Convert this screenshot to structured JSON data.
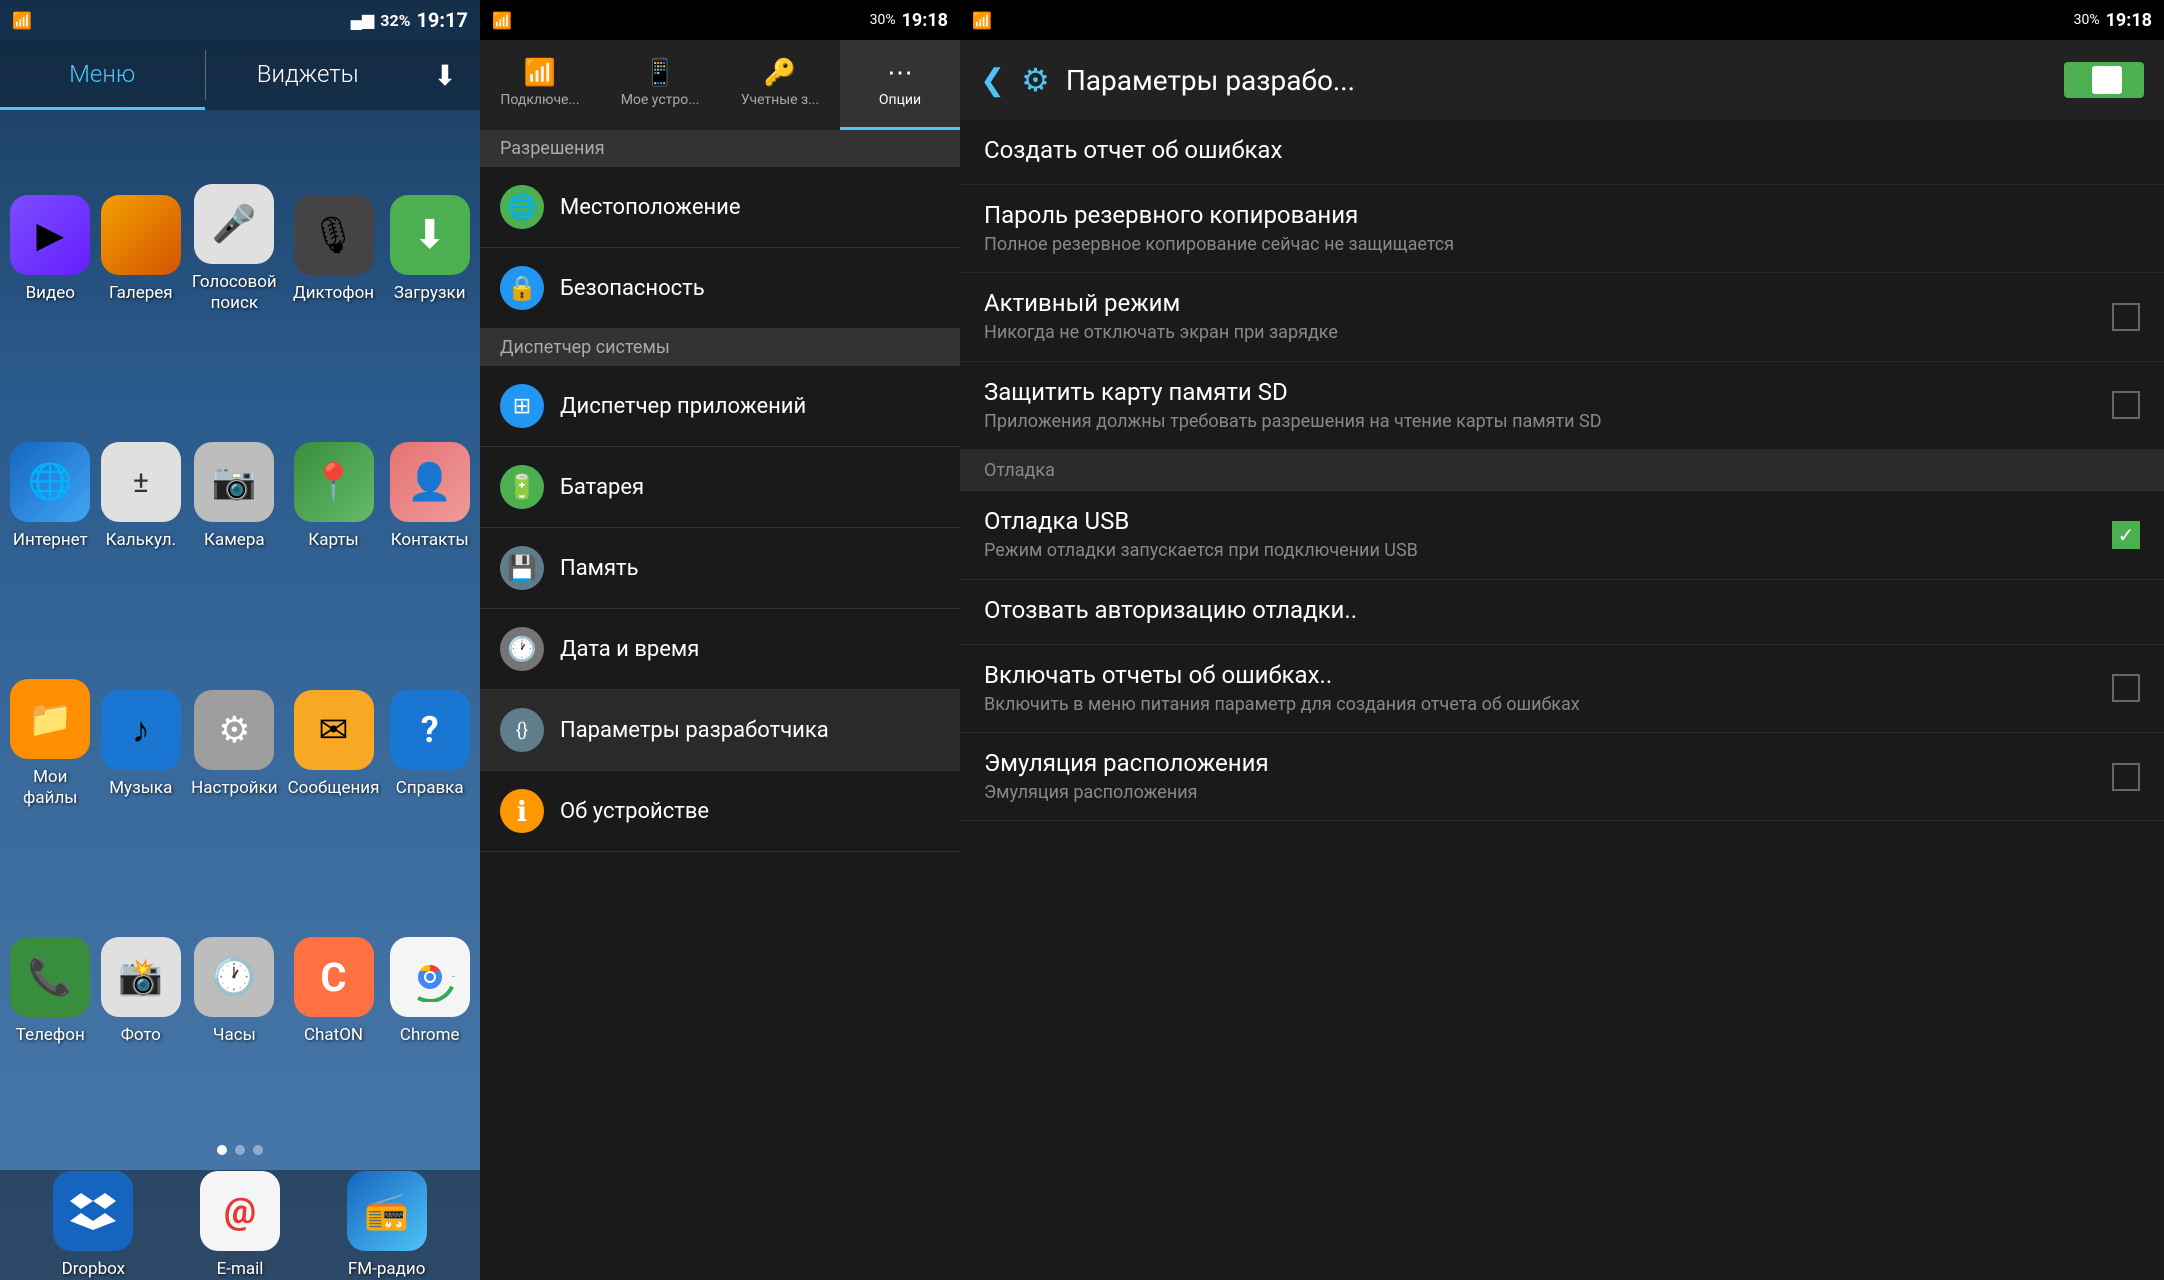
{
  "home": {
    "status": {
      "time": "19:17",
      "battery": "32%",
      "signal": "▂▄▆"
    },
    "tabs": [
      {
        "label": "Меню",
        "active": true
      },
      {
        "label": "Виджеты",
        "active": false
      }
    ],
    "apps": [
      {
        "id": "video",
        "label": "Видео",
        "icon": "▶",
        "color": "icon-video"
      },
      {
        "id": "gallery",
        "label": "Галерея",
        "icon": "🖼",
        "color": "icon-gallery"
      },
      {
        "id": "voice",
        "label": "Голосовой поиск",
        "icon": "🎤",
        "color": "icon-voice"
      },
      {
        "id": "dictaphone",
        "label": "Диктофон",
        "icon": "🎙",
        "color": "icon-dictaphone"
      },
      {
        "id": "downloads",
        "label": "Загрузки",
        "icon": "⬇",
        "color": "icon-downloads"
      },
      {
        "id": "internet",
        "label": "Интернет",
        "icon": "🌐",
        "color": "icon-internet"
      },
      {
        "id": "calc",
        "label": "Калькул.",
        "icon": "±",
        "color": "icon-calc"
      },
      {
        "id": "camera",
        "label": "Камера",
        "icon": "📷",
        "color": "icon-camera"
      },
      {
        "id": "maps",
        "label": "Карты",
        "icon": "📍",
        "color": "icon-maps"
      },
      {
        "id": "contacts",
        "label": "Контакты",
        "icon": "👤",
        "color": "icon-contacts"
      },
      {
        "id": "files",
        "label": "Мои файлы",
        "icon": "📁",
        "color": "icon-files"
      },
      {
        "id": "music",
        "label": "Музыка",
        "icon": "♪",
        "color": "icon-music"
      },
      {
        "id": "settings",
        "label": "Настройки",
        "icon": "⚙",
        "color": "icon-settings"
      },
      {
        "id": "messages",
        "label": "Сообщения",
        "icon": "✉",
        "color": "icon-messages"
      },
      {
        "id": "help",
        "label": "Справка",
        "icon": "?",
        "color": "icon-help"
      },
      {
        "id": "phone",
        "label": "Телефон",
        "icon": "📞",
        "color": "icon-phone"
      },
      {
        "id": "photos",
        "label": "Фото",
        "icon": "📸",
        "color": "icon-photos"
      },
      {
        "id": "clock",
        "label": "Часы",
        "icon": "🕐",
        "color": "icon-clock"
      },
      {
        "id": "chaton",
        "label": "ChatON",
        "icon": "C",
        "color": "icon-chaton"
      },
      {
        "id": "chrome",
        "label": "Chrome",
        "icon": "◎",
        "color": "icon-chrome"
      },
      {
        "id": "dropbox",
        "label": "Dropbox",
        "icon": "✦",
        "color": "icon-dropbox"
      },
      {
        "id": "email",
        "label": "E-mail",
        "icon": "@",
        "color": "icon-email"
      },
      {
        "id": "fm",
        "label": "FM-радио",
        "icon": "📻",
        "color": "icon-fm"
      }
    ]
  },
  "settings": {
    "status": {
      "time": "19:18",
      "battery": "30%"
    },
    "tabs": [
      {
        "label": "Подключе...",
        "icon": "📶",
        "active": false
      },
      {
        "label": "Мое устро...",
        "icon": "📱",
        "active": false
      },
      {
        "label": "Учетные з...",
        "icon": "🔑",
        "active": false
      },
      {
        "label": "Опции",
        "icon": "⋯",
        "active": true
      }
    ],
    "section": "Разрешения",
    "items": [
      {
        "label": "Местоположение",
        "icon": "🌐",
        "icon_bg": "#4caf50"
      },
      {
        "label": "Безопасность",
        "icon": "🔒",
        "icon_bg": "#2196f3"
      },
      {
        "label": "Диспетчер системы",
        "section": true
      },
      {
        "label": "Диспетчер приложений",
        "icon": "⊞",
        "icon_bg": "#2196f3"
      },
      {
        "label": "Батарея",
        "icon": "🔋",
        "icon_bg": "#4caf50"
      },
      {
        "label": "Память",
        "icon": "💾",
        "icon_bg": "#607d8b"
      },
      {
        "label": "Дата и время",
        "icon": "🕐",
        "icon_bg": "#9e9e9e"
      },
      {
        "label": "Параметры разработчика",
        "icon": "{}",
        "icon_bg": "#607d8b"
      },
      {
        "label": "Об устройстве",
        "icon": "ℹ",
        "icon_bg": "#ff9800"
      }
    ]
  },
  "developer": {
    "status": {
      "time": "19:18",
      "battery": "30%"
    },
    "title": "Параметры разрабо...",
    "toggle_on": true,
    "items": [
      {
        "id": "bug-report",
        "title": "Создать отчет об ошибках",
        "subtitle": "",
        "checkbox": false,
        "section": false
      },
      {
        "id": "backup-password",
        "title": "Пароль резервного копирования",
        "subtitle": "Полное резервное копирование сейчас не защищается",
        "checkbox": false,
        "section": false
      },
      {
        "id": "active-mode",
        "title": "Активный режим",
        "subtitle": "Никогда не отключать экран при зарядке",
        "checkbox": true,
        "checked": false,
        "section": false
      },
      {
        "id": "protect-sd",
        "title": "Защитить карту памяти SD",
        "subtitle": "Приложения должны требовать разрешения на чтение карты памяти SD",
        "checkbox": true,
        "checked": false,
        "section": false
      },
      {
        "id": "debug-section",
        "title": "Отладка",
        "subtitle": "",
        "checkbox": false,
        "section": true
      },
      {
        "id": "usb-debug",
        "title": "Отладка USB",
        "subtitle": "Режим отладки запускается при подключении USB",
        "checkbox": true,
        "checked": true,
        "section": false
      },
      {
        "id": "revoke-auth",
        "title": "Отозвать авторизацию отладки...",
        "subtitle": "",
        "checkbox": false,
        "section": false
      },
      {
        "id": "error-reports",
        "title": "Включать отчеты об ошибках..",
        "subtitle": "Включить в меню питания параметр для создания отчета об ошибках",
        "checkbox": true,
        "checked": false,
        "section": false
      },
      {
        "id": "mock-location",
        "title": "Эмуляция расположения",
        "subtitle": "Эмуляция расположения",
        "checkbox": true,
        "checked": false,
        "section": false
      }
    ]
  }
}
